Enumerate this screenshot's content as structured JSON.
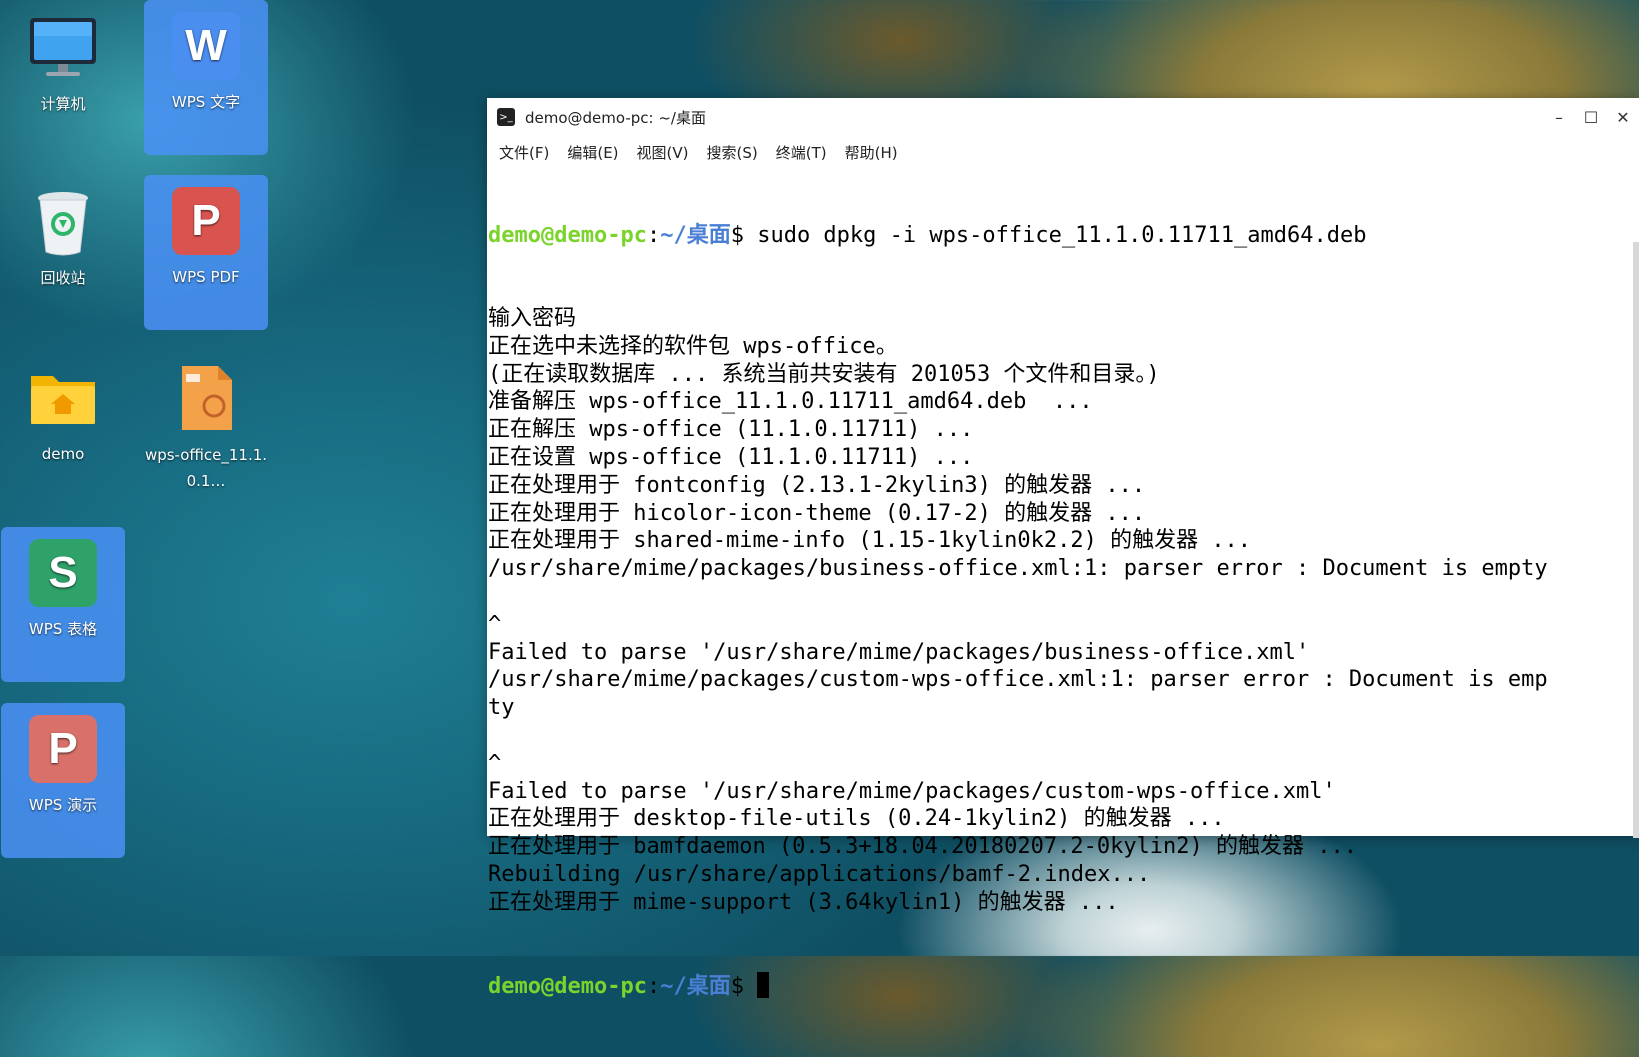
{
  "desktop": {
    "icons": [
      {
        "name": "计算机",
        "icon": "computer-icon"
      },
      {
        "name": "回收站",
        "icon": "trash-icon"
      },
      {
        "name": "demo",
        "icon": "home-folder-icon"
      },
      {
        "name": "wps-office_11.1.0.1…",
        "icon": "deb-package-icon"
      }
    ],
    "wps": {
      "writer": {
        "name": "WPS 文字",
        "glyph": "W",
        "color": "#4a8ef0"
      },
      "pdf": {
        "name": "WPS PDF",
        "glyph": "P",
        "color": "#d9534f"
      },
      "sheet": {
        "name": "WPS 表格",
        "glyph": "S",
        "color": "#2fa26a"
      },
      "present": {
        "name": "WPS 演示",
        "glyph": "P",
        "color": "#e07046"
      }
    }
  },
  "terminal": {
    "title": "demo@demo-pc: ~/桌面",
    "controls": {
      "minimize": "–",
      "maximize": "☐",
      "close": "✕"
    },
    "menu": [
      "文件(F)",
      "编辑(E)",
      "视图(V)",
      "搜索(S)",
      "终端(T)",
      "帮助(H)"
    ],
    "prompt": {
      "user": "demo@demo-pc",
      "sep": ":",
      "path": "~/桌面",
      "sign": "$ "
    },
    "command": "sudo dpkg -i wps-office_11.1.0.11711_amd64.deb",
    "output": [
      "输入密码",
      "正在选中未选择的软件包 wps-office。",
      "(正在读取数据库 ... 系统当前共安装有 201053 个文件和目录。)",
      "准备解压 wps-office_11.1.0.11711_amd64.deb  ...",
      "正在解压 wps-office (11.1.0.11711) ...",
      "正在设置 wps-office (11.1.0.11711) ...",
      "正在处理用于 fontconfig (2.13.1-2kylin3) 的触发器 ...",
      "正在处理用于 hicolor-icon-theme (0.17-2) 的触发器 ...",
      "正在处理用于 shared-mime-info (1.15-1kylin0k2.2) 的触发器 ...",
      "/usr/share/mime/packages/business-office.xml:1: parser error : Document is empty",
      "",
      "^",
      "Failed to parse '/usr/share/mime/packages/business-office.xml'",
      "/usr/share/mime/packages/custom-wps-office.xml:1: parser error : Document is emp",
      "ty",
      "",
      "^",
      "Failed to parse '/usr/share/mime/packages/custom-wps-office.xml'",
      "正在处理用于 desktop-file-utils (0.24-1kylin2) 的触发器 ...",
      "正在处理用于 bamfdaemon (0.5.3+18.04.20180207.2-0kylin2) 的触发器 ...",
      "Rebuilding /usr/share/applications/bamf-2.index...",
      "正在处理用于 mime-support (3.64kylin1) 的触发器 ..."
    ]
  }
}
